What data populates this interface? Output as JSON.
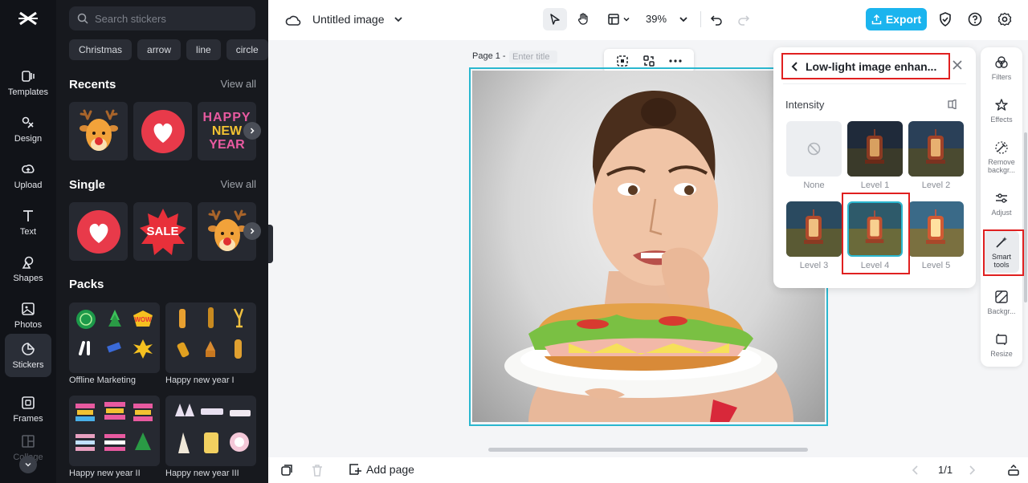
{
  "rail": {
    "items": [
      {
        "label": "Templates",
        "icon": "templates-icon"
      },
      {
        "label": "Design",
        "icon": "design-icon"
      },
      {
        "label": "Upload",
        "icon": "upload-icon"
      },
      {
        "label": "Text",
        "icon": "text-icon"
      },
      {
        "label": "Shapes",
        "icon": "shapes-icon"
      },
      {
        "label": "Photos",
        "icon": "photos-icon"
      },
      {
        "label": "Stickers",
        "icon": "stickers-icon",
        "active": true
      },
      {
        "label": "Frames",
        "icon": "frames-icon"
      },
      {
        "label": "Collage",
        "icon": "collage-icon"
      }
    ]
  },
  "panel": {
    "search_placeholder": "Search stickers",
    "chips": [
      "Christmas",
      "arrow",
      "line",
      "circle"
    ],
    "recents": {
      "title": "Recents",
      "view_all": "View all",
      "happy_text": [
        "HAPPY",
        "NEW",
        "YEAR"
      ]
    },
    "single": {
      "title": "Single",
      "view_all": "View all",
      "sale": "SALE"
    },
    "packs": {
      "title": "Packs",
      "items": [
        "Offline Marketing",
        "Happy new year I",
        "Happy new year II",
        "Happy new year III"
      ],
      "wow": "WOW"
    }
  },
  "topbar": {
    "title": "Untitled image",
    "zoom": "39%",
    "export": "Export"
  },
  "canvas": {
    "page_label": "Page 1 -",
    "title_placeholder": "Enter title"
  },
  "bottombar": {
    "add_page": "Add page",
    "pager": "1/1"
  },
  "popover": {
    "title": "Low-light image enhan...",
    "intensity": "Intensity",
    "levels": [
      "None",
      "Level 1",
      "Level 2",
      "Level 3",
      "Level 4",
      "Level 5"
    ],
    "selected_level": "Level 4"
  },
  "right_rail": {
    "items": [
      "Filters",
      "Effects",
      "Remove backgr...",
      "Adjust",
      "Smart tools",
      "Backgr...",
      "Resize"
    ],
    "active": "Smart tools"
  },
  "colors": {
    "accent": "#1bb4ee",
    "selection": "#2ab7cf",
    "highlight": "#e02020",
    "rail_bg": "#111318",
    "panel_bg": "#17191e"
  }
}
